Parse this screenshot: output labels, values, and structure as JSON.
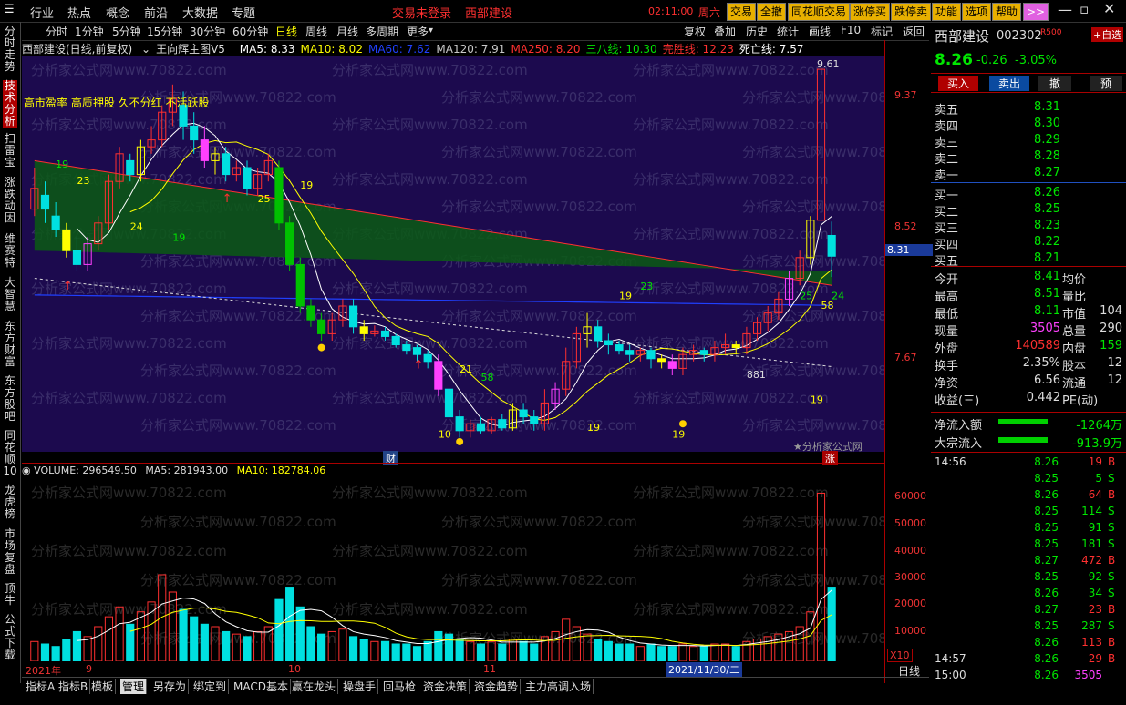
{
  "menu": {
    "items": [
      "行业",
      "热点",
      "概念",
      "前沿",
      "大数据",
      "专题"
    ],
    "status_login": "交易未登录",
    "status_stock": "西部建设",
    "clock": "02:11:00",
    "weekday": "周六",
    "buttons": [
      "交易",
      "全撤",
      "同花顺交易",
      "涨停买",
      "跌停卖",
      "功能",
      "选项",
      "帮助",
      ">>"
    ]
  },
  "left_tabs": [
    "分时走势",
    "技术分析",
    "扫雷宝",
    "涨跌动因",
    "维赛特",
    "大智慧",
    "东方财富",
    "东方股吧",
    "同花顺10",
    "龙虎榜",
    "市场复盘",
    "顶牛",
    "公式下载"
  ],
  "period_tabs": [
    "分时",
    "1分钟",
    "5分钟",
    "15分钟",
    "30分钟",
    "60分钟",
    "日线",
    "周线",
    "月线",
    "多周期",
    "更多"
  ],
  "tool_tabs": [
    "复权",
    "叠加",
    "历史",
    "统计",
    "画线",
    "F10",
    "标记",
    "返回"
  ],
  "indicator": {
    "stock_label": "西部建设(日线,前复权)",
    "formula": "王向辉主图V5",
    "items": [
      {
        "text": "MA5: 8.33",
        "color": "#ffffff"
      },
      {
        "text": "MA10: 8.02",
        "color": "#ffff00"
      },
      {
        "text": "MA60: 7.62",
        "color": "#2040ff"
      },
      {
        "text": "MA120: 7.91",
        "color": "#c8c8c8"
      },
      {
        "text": "MA250: 8.20",
        "color": "#ff3030"
      },
      {
        "text": "三八线: 10.30",
        "color": "#00e600"
      },
      {
        "text": "完胜线: 12.23",
        "color": "#ff3030"
      },
      {
        "text": "死亡线: 7.57",
        "color": "#ffffff"
      }
    ]
  },
  "chart_note": "高市盈率 高质押股 久不分红 不活跃股",
  "price_axis": [
    "9.37",
    "8.52",
    "8.31",
    "7.67"
  ],
  "top_price_label": "9.61",
  "watermark": "分析家公式网www.70822.com",
  "watermark_brand": "★分析家公式网",
  "marker_labels": [
    "19",
    "23",
    "24",
    "19",
    "25",
    "19",
    "23",
    "19",
    "21",
    "58",
    "881",
    "19",
    "25",
    "58",
    "19",
    "24",
    "19",
    "10"
  ],
  "event_tags": [
    "财",
    "涨"
  ],
  "volume": {
    "label": "VOLUME: 296549.50",
    "ma5": "MA5: 281943.00",
    "ma10": "MA10: 182784.06",
    "axis": [
      "60000",
      "50000",
      "40000",
      "30000",
      "20000",
      "10000"
    ],
    "unit": "X10"
  },
  "time_axis": {
    "labels": [
      "2021年",
      "9",
      "10",
      "11"
    ],
    "cursor_date": "2021/11/30/二",
    "period": "日线"
  },
  "bottom_tabs": [
    "指标A",
    "指标B",
    "模板",
    "管理",
    "另存为",
    "绑定到",
    "MACD基本",
    "赢在龙头",
    "操盘手",
    "回马枪",
    "资金决策",
    "资金趋势",
    "主力高调入场"
  ],
  "quote": {
    "name": "西部建设",
    "code": "002302",
    "tag": "R500",
    "add_self": "+自选",
    "price": "8.26",
    "change": "-0.26",
    "pct": "-3.05%",
    "actions": [
      "买入",
      "卖出",
      "撤",
      "预"
    ],
    "asks": [
      {
        "label": "卖五",
        "price": "8.31"
      },
      {
        "label": "卖四",
        "price": "8.30"
      },
      {
        "label": "卖三",
        "price": "8.29"
      },
      {
        "label": "卖二",
        "price": "8.28"
      },
      {
        "label": "卖一",
        "price": "8.27"
      }
    ],
    "bids": [
      {
        "label": "买一",
        "price": "8.26"
      },
      {
        "label": "买二",
        "price": "8.25"
      },
      {
        "label": "买三",
        "price": "8.23"
      },
      {
        "label": "买四",
        "price": "8.22"
      },
      {
        "label": "买五",
        "price": "8.21"
      }
    ],
    "stats": [
      {
        "k": "今开",
        "v": "8.41",
        "k2": "均价",
        "v2": ""
      },
      {
        "k": "最高",
        "v": "8.51",
        "k2": "量比",
        "v2": ""
      },
      {
        "k": "最低",
        "v": "8.11",
        "k2": "市值",
        "v2": "104"
      },
      {
        "k": "现量",
        "v": "3505",
        "k2": "总量",
        "v2": "290"
      },
      {
        "k": "外盘",
        "v": "140589",
        "k2": "内盘",
        "v2": "159"
      },
      {
        "k": "换手",
        "v": "2.35%",
        "k2": "股本",
        "v2": "12"
      },
      {
        "k": "净资",
        "v": "6.56",
        "k2": "流通",
        "v2": "12"
      },
      {
        "k": "收益(三)",
        "v": "0.442",
        "k2": "PE(动)",
        "v2": ""
      }
    ],
    "flows": [
      {
        "k": "净流入额",
        "v": "-1264万"
      },
      {
        "k": "大宗流入",
        "v": "-913.9万"
      }
    ],
    "ticks": [
      {
        "t": "14:56",
        "p": "8.26",
        "v": "19",
        "s": "B"
      },
      {
        "t": "",
        "p": "8.25",
        "v": "5",
        "s": "S"
      },
      {
        "t": "",
        "p": "8.26",
        "v": "64",
        "s": "B"
      },
      {
        "t": "",
        "p": "8.25",
        "v": "114",
        "s": "S"
      },
      {
        "t": "",
        "p": "8.25",
        "v": "91",
        "s": "S"
      },
      {
        "t": "",
        "p": "8.25",
        "v": "181",
        "s": "S"
      },
      {
        "t": "",
        "p": "8.27",
        "v": "472",
        "s": "B"
      },
      {
        "t": "",
        "p": "8.25",
        "v": "92",
        "s": "S"
      },
      {
        "t": "",
        "p": "8.26",
        "v": "34",
        "s": "S"
      },
      {
        "t": "",
        "p": "8.27",
        "v": "23",
        "s": "B"
      },
      {
        "t": "",
        "p": "8.25",
        "v": "287",
        "s": "S"
      },
      {
        "t": "",
        "p": "8.26",
        "v": "113",
        "s": "B"
      },
      {
        "t": "14:57",
        "p": "8.26",
        "v": "29",
        "s": "B"
      },
      {
        "t": "15:00",
        "p": "8.26",
        "v": "3505",
        "s": ""
      }
    ]
  },
  "candles": [
    [
      8.6,
      8.75,
      8.55,
      8.9
    ],
    [
      8.7,
      8.6,
      8.5,
      8.8
    ],
    [
      8.55,
      8.45,
      8.4,
      8.65
    ],
    [
      8.45,
      8.3,
      8.25,
      8.5
    ],
    [
      8.3,
      8.2,
      8.15,
      8.4
    ],
    [
      8.2,
      8.35,
      8.15,
      8.4
    ],
    [
      8.35,
      8.5,
      8.3,
      8.55
    ],
    [
      8.5,
      8.8,
      8.45,
      8.85
    ],
    [
      8.8,
      9.0,
      8.75,
      9.05
    ],
    [
      8.95,
      8.85,
      8.8,
      9.0
    ],
    [
      8.85,
      9.05,
      8.8,
      9.1
    ],
    [
      9.05,
      9.1,
      9.0,
      9.2
    ],
    [
      9.1,
      9.3,
      9.05,
      9.35
    ],
    [
      9.3,
      9.4,
      9.2,
      9.5
    ],
    [
      9.35,
      9.2,
      9.1,
      9.45
    ],
    [
      9.2,
      9.1,
      9.0,
      9.3
    ],
    [
      9.1,
      8.95,
      8.9,
      9.2
    ],
    [
      8.95,
      9.0,
      8.85,
      9.05
    ],
    [
      9.0,
      8.85,
      8.8,
      9.05
    ],
    [
      8.85,
      8.9,
      8.8,
      8.95
    ],
    [
      8.9,
      8.75,
      8.7,
      8.95
    ],
    [
      8.75,
      8.85,
      8.7,
      8.9
    ],
    [
      8.85,
      8.95,
      8.8,
      9.0
    ],
    [
      8.9,
      8.5,
      8.45,
      8.95
    ],
    [
      8.5,
      8.2,
      8.15,
      8.55
    ],
    [
      8.2,
      7.9,
      7.85,
      8.25
    ],
    [
      7.9,
      7.8,
      7.75,
      7.95
    ],
    [
      7.8,
      7.7,
      7.65,
      7.85
    ],
    [
      7.7,
      7.8,
      7.65,
      7.85
    ],
    [
      7.8,
      7.9,
      7.75,
      7.95
    ],
    [
      7.9,
      7.75,
      7.7,
      7.95
    ],
    [
      7.75,
      7.7,
      7.65,
      7.8
    ],
    [
      7.7,
      7.72,
      7.68,
      7.76
    ],
    [
      7.72,
      7.68,
      7.65,
      7.75
    ],
    [
      7.68,
      7.62,
      7.6,
      7.7
    ],
    [
      7.62,
      7.58,
      7.55,
      7.65
    ],
    [
      7.6,
      7.55,
      7.5,
      7.62
    ],
    [
      7.55,
      7.5,
      7.45,
      7.58
    ],
    [
      7.5,
      7.3,
      7.25,
      7.55
    ],
    [
      7.3,
      7.1,
      7.05,
      7.35
    ],
    [
      7.1,
      7.0,
      6.95,
      7.15
    ],
    [
      7.0,
      7.05,
      6.95,
      7.08
    ],
    [
      7.05,
      7.0,
      6.98,
      7.1
    ],
    [
      7.0,
      7.08,
      6.98,
      7.1
    ],
    [
      7.08,
      7.02,
      7.0,
      7.12
    ],
    [
      7.02,
      7.15,
      7.0,
      7.2
    ],
    [
      7.15,
      7.1,
      7.05,
      7.2
    ],
    [
      7.1,
      7.05,
      7.0,
      7.15
    ],
    [
      7.05,
      7.2,
      7.0,
      7.3
    ],
    [
      7.2,
      7.3,
      7.15,
      7.35
    ],
    [
      7.3,
      7.5,
      7.25,
      7.6
    ],
    [
      7.5,
      7.7,
      7.45,
      7.75
    ],
    [
      7.7,
      7.75,
      7.6,
      7.85
    ],
    [
      7.75,
      7.65,
      7.6,
      7.8
    ],
    [
      7.65,
      7.62,
      7.55,
      7.7
    ],
    [
      7.62,
      7.58,
      7.55,
      7.65
    ],
    [
      7.58,
      7.55,
      7.5,
      7.62
    ],
    [
      7.55,
      7.58,
      7.5,
      7.6
    ],
    [
      7.58,
      7.52,
      7.45,
      7.6
    ],
    [
      7.52,
      7.5,
      7.45,
      7.55
    ],
    [
      7.5,
      7.45,
      7.4,
      7.55
    ],
    [
      7.45,
      7.55,
      7.4,
      7.6
    ],
    [
      7.55,
      7.58,
      7.5,
      7.62
    ],
    [
      7.58,
      7.55,
      7.5,
      7.6
    ],
    [
      7.55,
      7.6,
      7.5,
      7.65
    ],
    [
      7.6,
      7.62,
      7.55,
      7.7
    ],
    [
      7.62,
      7.6,
      7.55,
      7.65
    ],
    [
      7.6,
      7.7,
      7.55,
      7.75
    ],
    [
      7.7,
      7.78,
      7.65,
      7.82
    ],
    [
      7.78,
      7.85,
      7.72,
      7.9
    ],
    [
      7.85,
      7.95,
      7.8,
      8.0
    ],
    [
      7.95,
      8.1,
      7.9,
      8.15
    ],
    [
      8.1,
      8.25,
      8.05,
      8.3
    ],
    [
      8.25,
      8.52,
      8.2,
      8.55
    ],
    [
      8.52,
      9.61,
      8.5,
      9.61
    ],
    [
      8.41,
      8.26,
      8.11,
      8.51
    ]
  ],
  "volumes": [
    8,
    7,
    6,
    9,
    12,
    10,
    14,
    18,
    22,
    15,
    20,
    24,
    35,
    28,
    21,
    18,
    15,
    14,
    12,
    11,
    10,
    12,
    14,
    25,
    30,
    22,
    14,
    11,
    12,
    13,
    10,
    9,
    8,
    8,
    7,
    7,
    6,
    8,
    12,
    11,
    9,
    8,
    7,
    8,
    7,
    9,
    8,
    7,
    10,
    12,
    17,
    14,
    11,
    9,
    8,
    7,
    7,
    6,
    7,
    6,
    6,
    7,
    6,
    6,
    7,
    7,
    6,
    8,
    9,
    10,
    11,
    12,
    14,
    20,
    68,
    30
  ]
}
